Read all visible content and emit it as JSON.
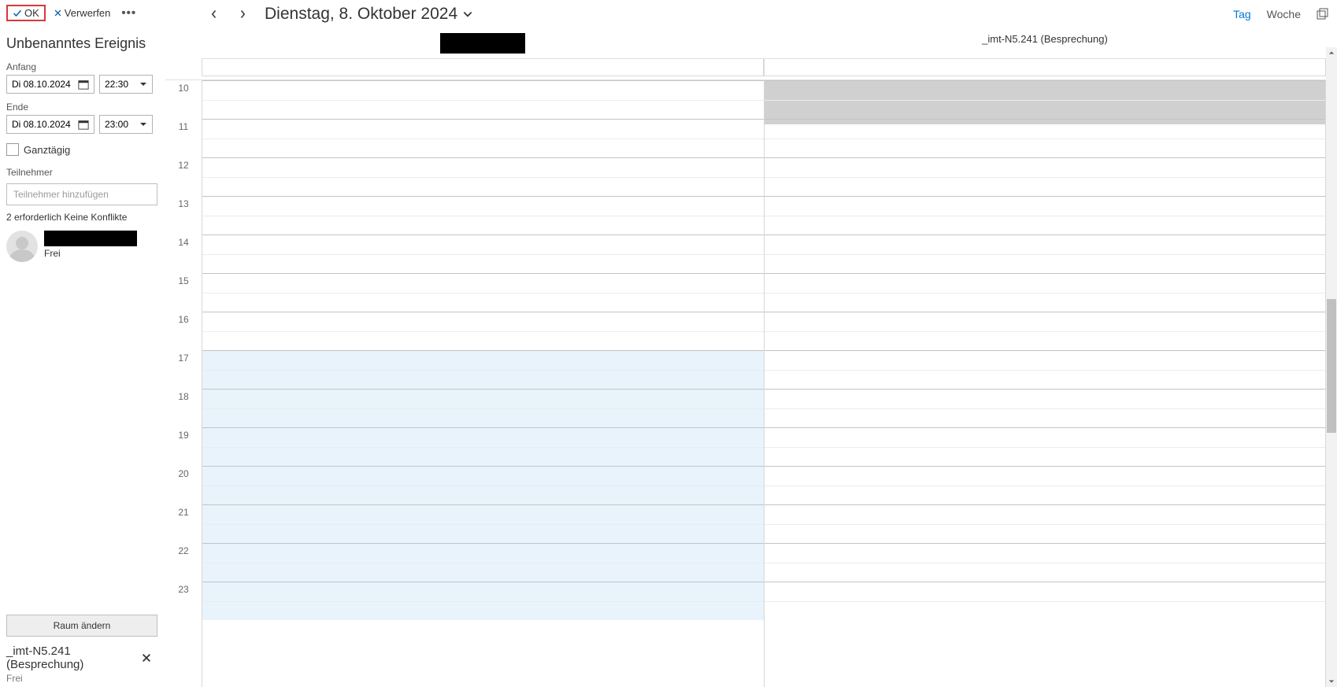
{
  "toolbar": {
    "ok_label": "OK",
    "discard_label": "Verwerfen"
  },
  "event": {
    "title": "Unbenanntes Ereignis",
    "start_label": "Anfang",
    "start_date": "Di 08.10.2024",
    "start_time": "22:30",
    "end_label": "Ende",
    "end_date": "Di 08.10.2024",
    "end_time": "23:00",
    "allday_label": "Ganztägig",
    "attendee_label": "Teilnehmer",
    "attendee_placeholder": "Teilnehmer hinzufügen",
    "required_text": "2 erforderlich Keine Konflikte",
    "attendee_status": "Frei",
    "change_room_label": "Raum ändern",
    "room_name": "_imt-N5.241 (Besprechung)",
    "room_status": "Frei"
  },
  "calendar": {
    "date_title": "Dienstag, 8. Oktober 2024",
    "view_day": "Tag",
    "view_week": "Woche",
    "col2_header": "_imt-N5.241 (Besprechung)",
    "hours": [
      "10",
      "11",
      "12",
      "13",
      "14",
      "15",
      "16",
      "17",
      "18",
      "19",
      "20",
      "21",
      "22",
      "23"
    ],
    "after_hours_start_index": 7
  }
}
